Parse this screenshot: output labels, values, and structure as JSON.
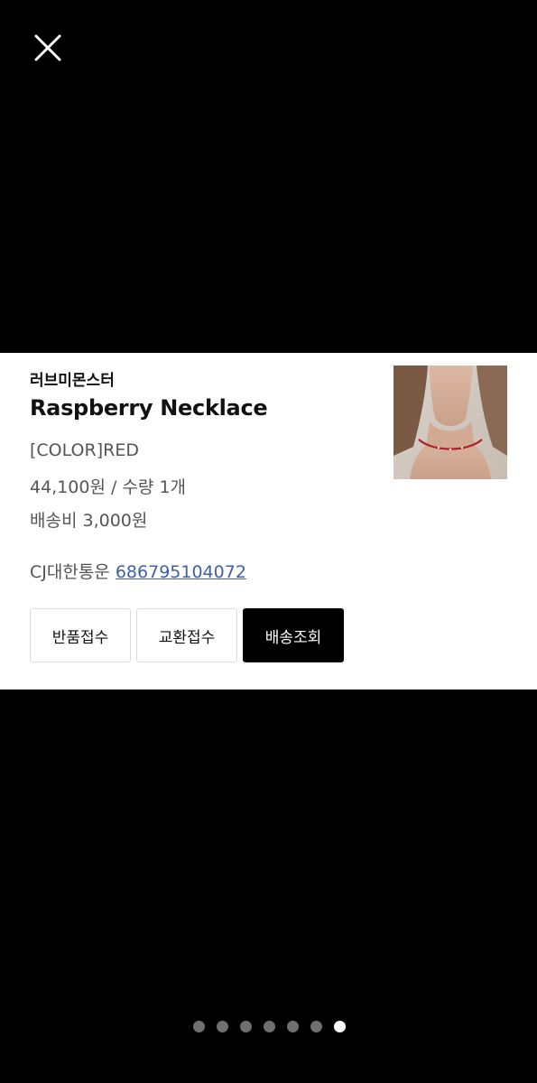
{
  "order_card": {
    "brand": "러브미몬스터",
    "product_name": "Raspberry Necklace",
    "option": "[COLOR]RED",
    "price_qty": "44,100원 / 수량 1개",
    "shipping_fee": "배송비 3,000원",
    "carrier": "CJ대한통운",
    "tracking_number": "686795104072",
    "buttons": {
      "return_label": "반품접수",
      "exchange_label": "교환접수",
      "track_label": "배송조회"
    }
  },
  "pager": {
    "total": 7,
    "active_index": 6
  },
  "icons": {
    "close": "close-icon"
  },
  "colors": {
    "background": "#000000",
    "card": "#ffffff",
    "link": "#3f5fa6",
    "primary_button": "#000000",
    "dot_inactive": "#6f6f6f",
    "dot_active": "#ffffff"
  }
}
